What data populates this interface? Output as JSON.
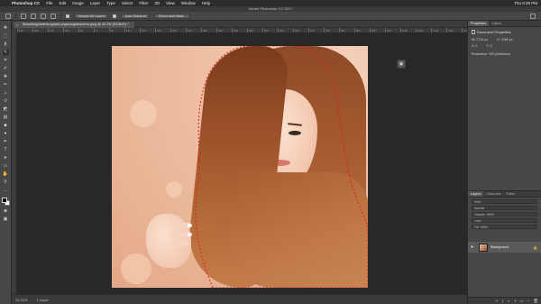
{
  "menubar": {
    "apple": "",
    "app": "Photoshop CC",
    "items": [
      "File",
      "Edit",
      "Image",
      "Layer",
      "Type",
      "Select",
      "Filter",
      "3D",
      "View",
      "Window",
      "Help"
    ],
    "clock": "Thu 8:28 PM"
  },
  "titlebar": {
    "title": "Adobe Photoshop CC 2017"
  },
  "options": {
    "sample_all_layers": "Sample All Layers",
    "auto_enhance": "Auto-Enhance",
    "select_and_mask": "Select and Mask..."
  },
  "document": {
    "tab_label": "BeautifulgirlwithlonghairLongstraighthairfrea.jpeg @ 33.3% (RGB/8*) *",
    "close_glyph": "×"
  },
  "ruler": {
    "ticks": [
      "250",
      "200",
      "150",
      "100",
      "50",
      "0",
      "50",
      "100",
      "150",
      "200",
      "250",
      "300",
      "350",
      "400",
      "450",
      "500",
      "550",
      "600",
      "650",
      "700",
      "750",
      "800",
      "850",
      "900",
      "950",
      "1000",
      "1050",
      "1100",
      "1150",
      "1200"
    ]
  },
  "status": {
    "zoom": "33.33%",
    "info": "1 Layer"
  },
  "properties": {
    "tabs": [
      "Properties",
      "Adjust"
    ],
    "header": "Document Properties",
    "width": "W: 2724 px",
    "height": "H: 2268 px",
    "x": "X: 0",
    "y": "Y: 0",
    "resolution": "Resolution: 300 pixels/inch"
  },
  "layers": {
    "tabs": [
      "Layers",
      "Channels",
      "Paths"
    ],
    "kind_label": "Kind",
    "mode_label": "Normal",
    "opacity_label": "Opacity: 100%",
    "lock_label": "Lock:",
    "fill_label": "Fill: 100%",
    "layer_name": "Background"
  },
  "icons": {
    "eye": "●",
    "lock": "🔒",
    "float": "▣"
  },
  "colors": {
    "accent": "#535353",
    "selection_marquee": "#e02020",
    "foreground": "#000000",
    "background": "#ffffff"
  }
}
